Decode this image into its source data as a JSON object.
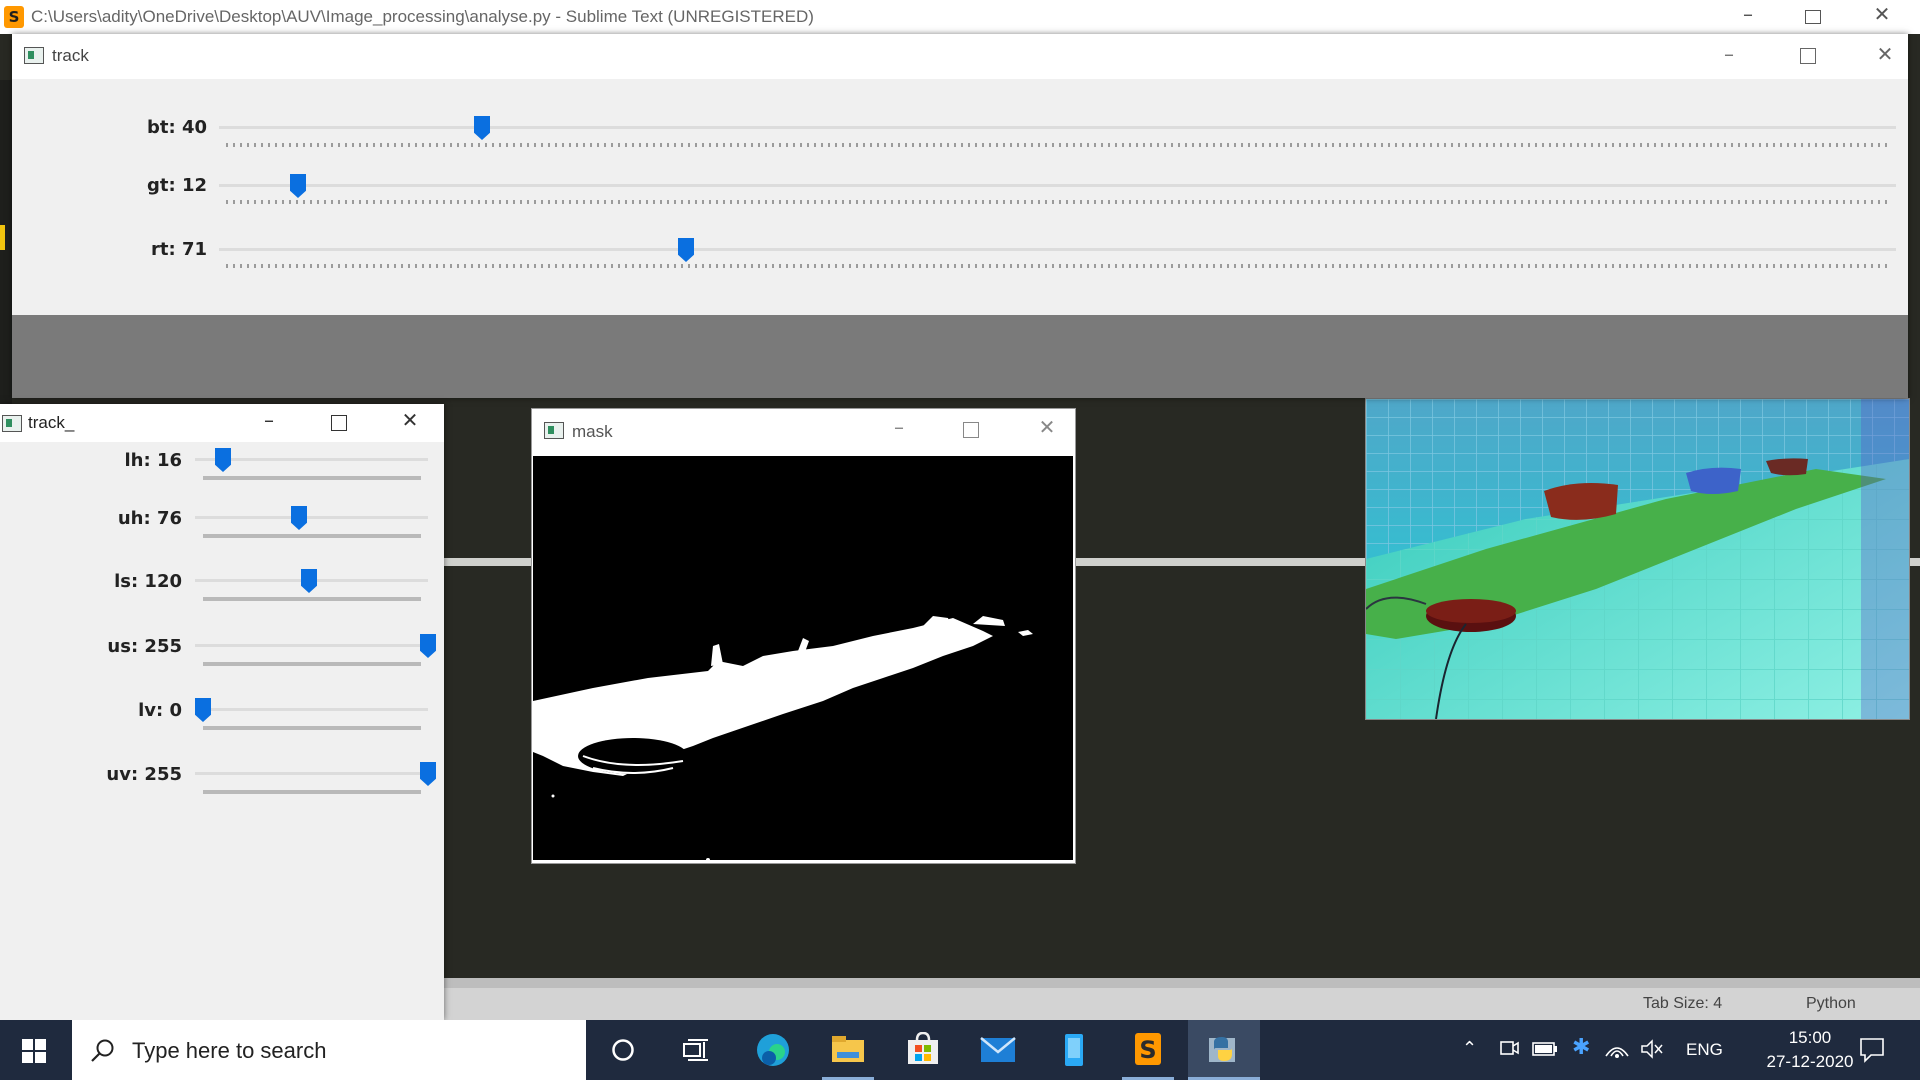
{
  "sublime": {
    "title": "C:\\Users\\adity\\OneDrive\\Desktop\\AUV\\Image_processing\\analyse.py - Sublime Text (UNREGISTERED)",
    "logo": "S",
    "status": {
      "tab_size": "Tab Size: 4",
      "syntax": "Python"
    }
  },
  "track_window": {
    "title": "track",
    "trackbars": [
      {
        "label": "bt: 40",
        "value": 40,
        "max": 255
      },
      {
        "label": "gt: 12",
        "value": 12,
        "max": 255
      },
      {
        "label": "rt: 71",
        "value": 71,
        "max": 255
      }
    ]
  },
  "track2_window": {
    "title": "track_",
    "trackbars": [
      {
        "label": "lh: 16",
        "value": 16,
        "max": 179
      },
      {
        "label": "uh: 76",
        "value": 76,
        "max": 179
      },
      {
        "label": "ls: 120",
        "value": 120,
        "max": 255
      },
      {
        "label": "us: 255",
        "value": 255,
        "max": 255
      },
      {
        "label": "lv: 0",
        "value": 0,
        "max": 255
      },
      {
        "label": "uv: 255",
        "value": 255,
        "max": 255
      }
    ]
  },
  "mask_window": {
    "title": "mask"
  },
  "taskbar": {
    "search_placeholder": "Type here to search",
    "apps": [
      "cortana-icon",
      "task-view-icon",
      "edge-icon",
      "file-explorer-icon",
      "store-icon",
      "mail-icon",
      "app-icon",
      "sublime-text-icon",
      "python-icon"
    ],
    "language": "ENG",
    "time": "15:00",
    "date": "27-12-2020"
  },
  "colors": {
    "accent": "#0a6fe0",
    "editor_bg": "#282923",
    "taskbar_bg": "#1f2a3e"
  }
}
